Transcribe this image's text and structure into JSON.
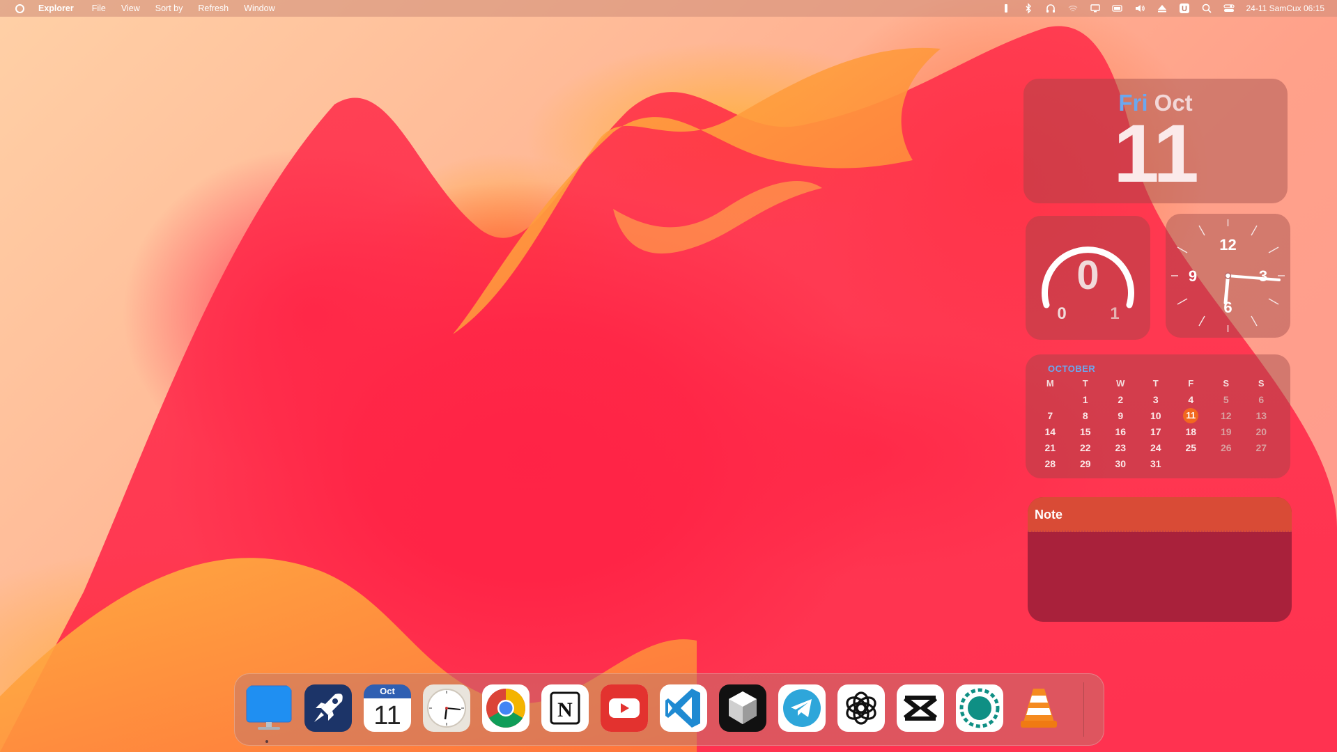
{
  "menubar": {
    "app_name": "Explorer",
    "menus": [
      "File",
      "View",
      "Sort by",
      "Refresh",
      "Window"
    ],
    "status_icons": [
      "battery-icon",
      "bluetooth-icon",
      "headphones-icon",
      "wifi-icon",
      "display-icon",
      "battery-status-icon",
      "volume-icon",
      "eject-icon",
      "user-badge-icon",
      "search-icon",
      "control-center-icon"
    ],
    "user_badge": "U",
    "datetime": "24-11 SamCux 06:15"
  },
  "widgets": {
    "date": {
      "weekday": "Fri",
      "month": "Oct",
      "day": "11"
    },
    "gauge": {
      "value": "0",
      "min": "0",
      "max": "1"
    },
    "clock": {
      "numerals": [
        "12",
        "3",
        "6",
        "9"
      ],
      "time": "06:15"
    },
    "calendar": {
      "month": "OCTOBER",
      "headers": [
        "M",
        "T",
        "W",
        "T",
        "F",
        "S",
        "S"
      ],
      "weeks": [
        [
          "",
          "1",
          "2",
          "3",
          "4",
          "5",
          "6"
        ],
        [
          "7",
          "8",
          "9",
          "10",
          "11",
          "12",
          "13"
        ],
        [
          "14",
          "15",
          "16",
          "17",
          "18",
          "19",
          "20"
        ],
        [
          "21",
          "22",
          "23",
          "24",
          "25",
          "26",
          "27"
        ],
        [
          "28",
          "29",
          "30",
          "31",
          "",
          "",
          ""
        ]
      ],
      "today": "11"
    },
    "note": {
      "title": "Note"
    }
  },
  "dock": {
    "items": [
      {
        "name": "finder-icon",
        "label": "Desktop"
      },
      {
        "name": "launchpad-rocket-icon",
        "label": "Launchpad"
      },
      {
        "name": "calendar-app-icon",
        "label": "Calendar",
        "month": "Oct",
        "day": "11"
      },
      {
        "name": "clock-app-icon",
        "label": "Clock"
      },
      {
        "name": "chrome-icon",
        "label": "Chrome"
      },
      {
        "name": "notion-icon",
        "label": "Notion",
        "glyph": "N"
      },
      {
        "name": "youtube-icon",
        "label": "YouTube"
      },
      {
        "name": "vscode-icon",
        "label": "VS Code"
      },
      {
        "name": "cube-app-icon",
        "label": "App"
      },
      {
        "name": "telegram-icon",
        "label": "Telegram"
      },
      {
        "name": "chatgpt-icon",
        "label": "ChatGPT"
      },
      {
        "name": "capcut-icon",
        "label": "CapCut"
      },
      {
        "name": "settings-ring-icon",
        "label": "Settings"
      },
      {
        "name": "vlc-icon",
        "label": "VLC"
      }
    ]
  },
  "colors": {
    "accent_blue": "#6aa8f0",
    "today_orange": "#f2681f",
    "note_header": "#d94b36",
    "note_body": "#a9213b"
  }
}
